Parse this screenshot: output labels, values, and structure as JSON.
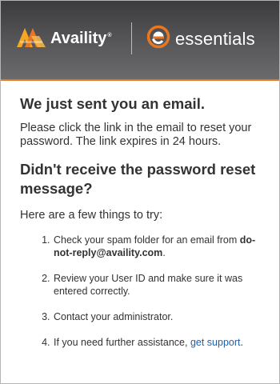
{
  "header": {
    "brand_name": "Availity",
    "brand_tm": "®",
    "product_name": "essentials",
    "colors": {
      "accent": "#e87722",
      "header_bg": "#4a4a4c",
      "link": "#1a5fb4"
    },
    "icons": {
      "brand_logo": "availity-logo-icon",
      "product_logo": "essentials-logo-icon"
    }
  },
  "main": {
    "title": "We just sent you an email.",
    "lead": "Please click the link in the email to reset your password. The link expires in 24 hours.",
    "subtitle": "Didn't receive the password reset message?",
    "intro": "Here are a few things to try:",
    "steps": [
      {
        "text": "Check your spam folder for an email from",
        "email": "do-not-reply@availity.com",
        "suffix": "."
      },
      {
        "text": "Review your User ID and make sure it was entered correctly."
      },
      {
        "text": "Contact your administrator."
      },
      {
        "text": "If you need further assistance,",
        "link_label": "get support",
        "suffix": "."
      }
    ]
  }
}
